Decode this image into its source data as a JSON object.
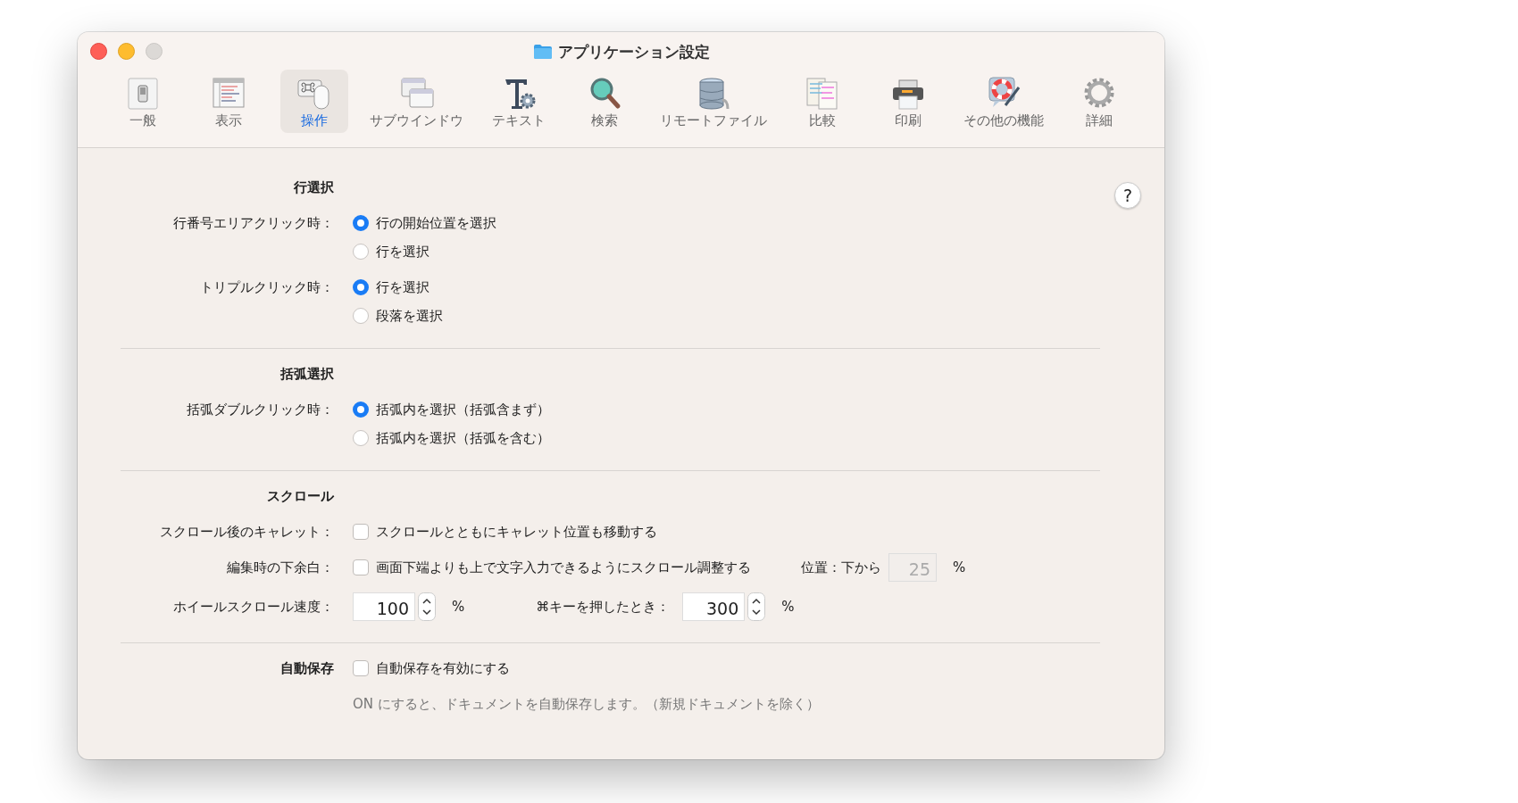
{
  "window": {
    "title": "アプリケーション設定"
  },
  "toolbar": {
    "tabs": [
      {
        "label": "一般",
        "selected": false
      },
      {
        "label": "表示",
        "selected": false
      },
      {
        "label": "操作",
        "selected": true
      },
      {
        "label": "サブウインドウ",
        "selected": false
      },
      {
        "label": "テキスト",
        "selected": false
      },
      {
        "label": "検索",
        "selected": false
      },
      {
        "label": "リモートファイル",
        "selected": false
      },
      {
        "label": "比較",
        "selected": false
      },
      {
        "label": "印刷",
        "selected": false
      },
      {
        "label": "その他の機能",
        "selected": false
      },
      {
        "label": "詳細",
        "selected": false
      }
    ]
  },
  "help_button": "?",
  "sections": [
    {
      "title": "行選択",
      "rows": [
        {
          "kind": "radio",
          "label": "行番号エリアクリック時：",
          "options": [
            {
              "label": "行の開始位置を選択",
              "selected": true
            },
            {
              "label": "行を選択",
              "selected": false
            }
          ]
        },
        {
          "kind": "radio",
          "label": "トリプルクリック時：",
          "options": [
            {
              "label": "行を選択",
              "selected": true
            },
            {
              "label": "段落を選択",
              "selected": false
            }
          ]
        }
      ]
    },
    {
      "title": "括弧選択",
      "rows": [
        {
          "kind": "radio",
          "label": "括弧ダブルクリック時：",
          "options": [
            {
              "label": "括弧内を選択（括弧含まず）",
              "selected": true
            },
            {
              "label": "括弧内を選択（括弧を含む）",
              "selected": false
            }
          ]
        }
      ]
    },
    {
      "title": "スクロール",
      "rows": [
        {
          "kind": "checkbox",
          "label": "スクロール後のキャレット：",
          "text": "スクロールとともにキャレット位置も移動する",
          "checked": false
        },
        {
          "kind": "checkbox",
          "label": "編集時の下余白：",
          "text": "画面下端よりも上で文字入力できるようにスクロール調整する",
          "checked": false,
          "extra": {
            "label": "位置：下から",
            "value": "25",
            "unit": "%",
            "disabled": true
          }
        },
        {
          "kind": "number",
          "label": "ホイールスクロール速度：",
          "value": "100",
          "unit": "%",
          "extra": {
            "label": "⌘キーを押したとき：",
            "value": "300",
            "unit": "%"
          }
        }
      ]
    },
    {
      "title": "自動保存",
      "rows": [
        {
          "kind": "checkbox",
          "text": "自動保存を有効にする",
          "checked": false
        },
        {
          "kind": "note",
          "text": "ON にすると、ドキュメントを自動保存します。（新規ドキュメントを除く）"
        }
      ]
    }
  ]
}
